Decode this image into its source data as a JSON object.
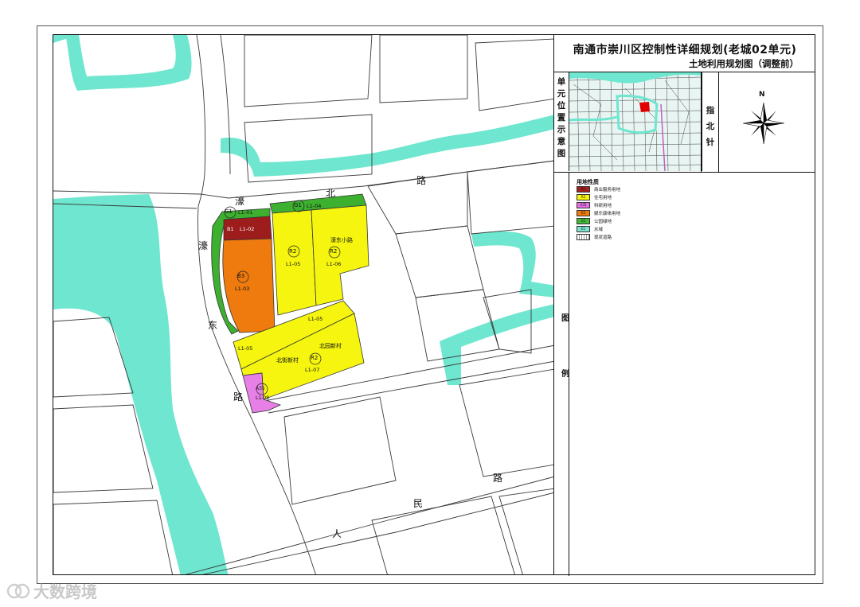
{
  "title": {
    "main": "南通市崇川区控制性详细规划(老城02单元)",
    "sub": "土地利用规划图（调整前）"
  },
  "side_labels": {
    "locator": "单元位置示意图",
    "compass": "指北针",
    "legend": "图例",
    "north": "N"
  },
  "legend": {
    "title": "用地性质",
    "items": [
      {
        "code": "B1",
        "label": "商业服务用地",
        "color": "#a51e1e"
      },
      {
        "code": "R2",
        "label": "住宅用地",
        "color": "#f7f00a"
      },
      {
        "code": "A35",
        "label": "科研用地",
        "color": "#e46fe4"
      },
      {
        "code": "B3",
        "label": "娱乐康体用地",
        "color": "#f07b0b"
      },
      {
        "code": "G1",
        "label": "公园绿地",
        "color": "#42b93a"
      },
      {
        "code": "E1",
        "label": "水域",
        "color": "#7de3cf"
      },
      {
        "code": "",
        "label": "现状道路",
        "color": "#ffffff"
      }
    ]
  },
  "colors": {
    "water": "#6fe6cf",
    "road_line": "#3a3a3a",
    "park": "#3db02f",
    "commercial": "#9d1c1c",
    "residential": "#f5f50f",
    "recreation": "#ef7a0d",
    "research": "#e680e6"
  },
  "road_labels": {
    "haobei": [
      "濠",
      "北",
      "路"
    ],
    "haodong": [
      "濠",
      "东",
      "路"
    ],
    "renmin": [
      "路",
      "民",
      "人"
    ]
  },
  "parcels": {
    "g1_01": {
      "code": "G1",
      "id": "L1-01"
    },
    "b1_02": {
      "code": "B1",
      "id": "L1-02"
    },
    "b3_03": {
      "code": "B3",
      "id": "L1-03"
    },
    "g1_04": {
      "code": "G1",
      "id": "L1-04"
    },
    "r2_05a": {
      "code": "R2",
      "id": "L1-05"
    },
    "r2_06": {
      "code": "R2",
      "id": "L1-06"
    },
    "l1_05b": {
      "id": "L1-05"
    },
    "l1_05c": {
      "id": "L1-05"
    },
    "r2_07": {
      "code": "R2",
      "id": "L1-07"
    },
    "a35_08": {
      "code": "A35",
      "id": "L1-08"
    }
  },
  "place_names": {
    "haodong_xiaolu": "濠东小路",
    "beijie_xincun": "北街新村",
    "beiyuan_xincun": "北园新村"
  },
  "watermark": "大数跨境"
}
